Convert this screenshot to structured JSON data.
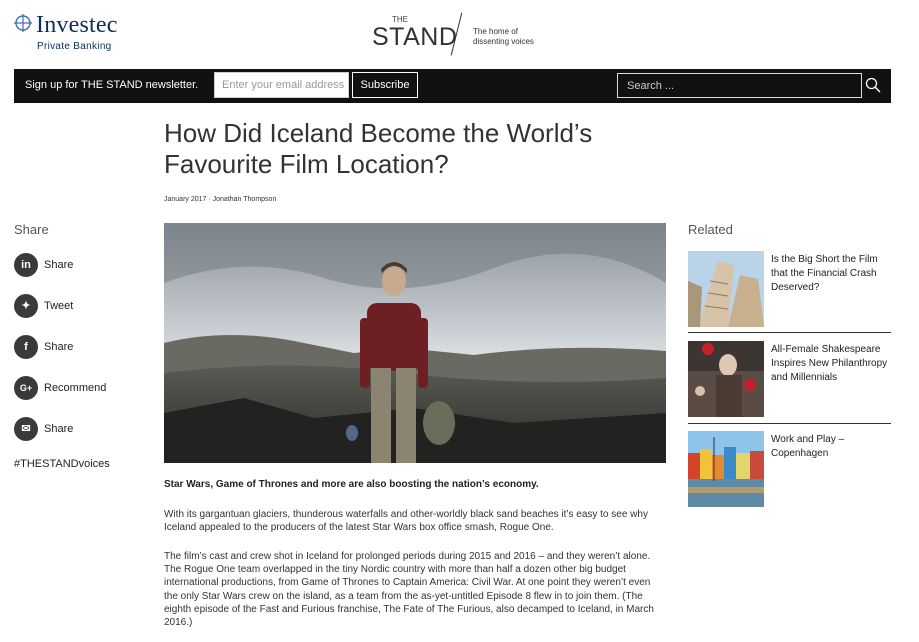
{
  "brand": {
    "name": "Investec",
    "subtitle": "Private Banking"
  },
  "site": {
    "the": "THE",
    "name": "STAND",
    "tagline": "The home of dissenting voices"
  },
  "newsletter": {
    "label": "Sign up for THE STAND newsletter.",
    "email_placeholder": "Enter your email address",
    "subscribe_label": "Subscribe"
  },
  "search": {
    "placeholder": "Search ..."
  },
  "article": {
    "title": "How Did Iceland Become the World’s Favourite Film Location?",
    "byline": "January 2017 · Jonathan Thompson",
    "lead": "Star Wars, Game of Thrones and more are also boosting the nation’s economy.",
    "paragraphs": [
      "With its gargantuan glaciers, thunderous waterfalls and other-worldly black sand beaches it’s easy to see why Iceland appealed to the producers of the latest Star Wars box office smash, Rogue One.",
      "The film’s cast and crew shot in Iceland for prolonged periods during 2015 and 2016 – and they weren’t alone. The Rogue One team overlapped in the tiny Nordic country with more than half a dozen other big budget international productions, from Game of Thrones to Captain America: Civil War. At one point they weren’t even the only Star Wars crew on the island, as a team from the as-yet-untitled Episode 8 flew in to join them. (The eighth episode of the Fast and Furious franchise, The Fate of The Furious, also decamped to Iceland, in March 2016.)"
    ]
  },
  "share": {
    "heading": "Share",
    "items": [
      {
        "icon": "linkedin-icon",
        "glyph": "in",
        "label": "Share"
      },
      {
        "icon": "twitter-icon",
        "glyph": "✦",
        "label": "Tweet"
      },
      {
        "icon": "facebook-icon",
        "glyph": "f",
        "label": "Share"
      },
      {
        "icon": "google-plus-icon",
        "glyph": "G+",
        "label": "Recommend"
      },
      {
        "icon": "email-icon",
        "glyph": "✉",
        "label": "Share"
      }
    ],
    "hashtag": "#THESTANDvoices"
  },
  "related": {
    "heading": "Related",
    "items": [
      {
        "title": "Is the Big Short the Film that the Financial Crash Deserved?"
      },
      {
        "title": "All-Female Shakespeare Inspires New Philanthropy and Millennials"
      },
      {
        "title": "Work and Play – Copenhagen"
      }
    ]
  }
}
